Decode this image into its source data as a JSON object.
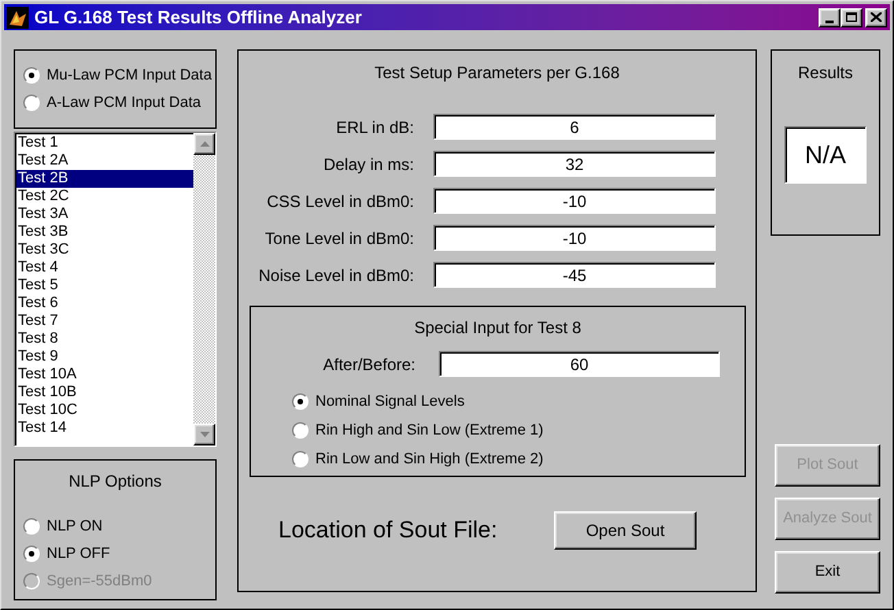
{
  "window": {
    "title": "GL G.168 Test Results Offline Analyzer"
  },
  "input_format": [
    {
      "label": "Mu-Law PCM Input Data",
      "selected": true
    },
    {
      "label": "A-Law PCM Input Data",
      "selected": false
    }
  ],
  "tests": [
    {
      "label": "Test 1",
      "selected": false
    },
    {
      "label": "Test 2A",
      "selected": false
    },
    {
      "label": "Test 2B",
      "selected": true
    },
    {
      "label": "Test 2C",
      "selected": false
    },
    {
      "label": "Test 3A",
      "selected": false
    },
    {
      "label": "Test 3B",
      "selected": false
    },
    {
      "label": "Test 3C",
      "selected": false
    },
    {
      "label": "Test 4",
      "selected": false
    },
    {
      "label": "Test 5",
      "selected": false
    },
    {
      "label": "Test 6",
      "selected": false
    },
    {
      "label": "Test 7",
      "selected": false
    },
    {
      "label": "Test 8",
      "selected": false
    },
    {
      "label": "Test 9",
      "selected": false
    },
    {
      "label": "Test 10A",
      "selected": false
    },
    {
      "label": "Test 10B",
      "selected": false
    },
    {
      "label": "Test 10C",
      "selected": false
    },
    {
      "label": "Test 14",
      "selected": false
    }
  ],
  "nlp_options": {
    "title": "NLP Options",
    "options": [
      {
        "label": "NLP ON",
        "selected": false,
        "disabled": false
      },
      {
        "label": "NLP OFF",
        "selected": true,
        "disabled": false
      },
      {
        "label": "Sgen=-55dBm0",
        "selected": false,
        "disabled": true
      }
    ]
  },
  "setup": {
    "title": "Test Setup Parameters per G.168",
    "fields": [
      {
        "label": "ERL in dB:",
        "value": "6"
      },
      {
        "label": "Delay in ms:",
        "value": "32"
      },
      {
        "label": "CSS Level in dBm0:",
        "value": "-10"
      },
      {
        "label": "Tone Level in dBm0:",
        "value": "-10"
      },
      {
        "label": "Noise Level in dBm0:",
        "value": "-45"
      }
    ]
  },
  "special": {
    "title": "Special Input for Test 8",
    "field": {
      "label": "After/Before:",
      "value": "60"
    },
    "options": [
      {
        "label": "Nominal Signal Levels",
        "selected": true
      },
      {
        "label": "Rin High and Sin Low (Extreme 1)",
        "selected": false
      },
      {
        "label": "Rin Low and Sin High (Extreme 2)",
        "selected": false
      }
    ]
  },
  "location": {
    "label": "Location of Sout File:",
    "button": "Open Sout"
  },
  "results": {
    "title": "Results",
    "value": "N/A"
  },
  "buttons": [
    {
      "label": "Plot Sout",
      "disabled": true
    },
    {
      "label": "Analyze Sout",
      "disabled": true
    },
    {
      "label": "Exit",
      "disabled": false
    }
  ]
}
